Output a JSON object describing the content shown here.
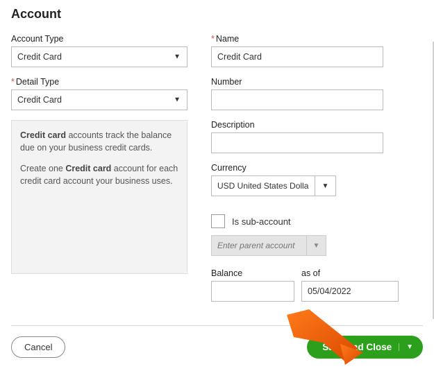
{
  "title": "Account",
  "left": {
    "account_type_label": "Account Type",
    "account_type_value": "Credit Card",
    "detail_type_label": "Detail Type",
    "detail_type_value": "Credit Card",
    "info_line1_strong": "Credit card",
    "info_line1_rest": " accounts track the balance due on your business credit cards.",
    "info_line2_pre": "Create one ",
    "info_line2_strong": "Credit card",
    "info_line2_rest": " account for each credit card account your business uses."
  },
  "right": {
    "name_label": "Name",
    "name_value": "Credit Card",
    "number_label": "Number",
    "number_value": "",
    "description_label": "Description",
    "description_value": "",
    "currency_label": "Currency",
    "currency_value": "USD United States Dollar",
    "sub_account_label": "Is sub-account",
    "parent_placeholder": "Enter parent account",
    "balance_label": "Balance",
    "balance_value": "",
    "asof_label": "as of",
    "asof_value": "05/04/2022"
  },
  "footer": {
    "cancel": "Cancel",
    "save": "Save and Close"
  }
}
